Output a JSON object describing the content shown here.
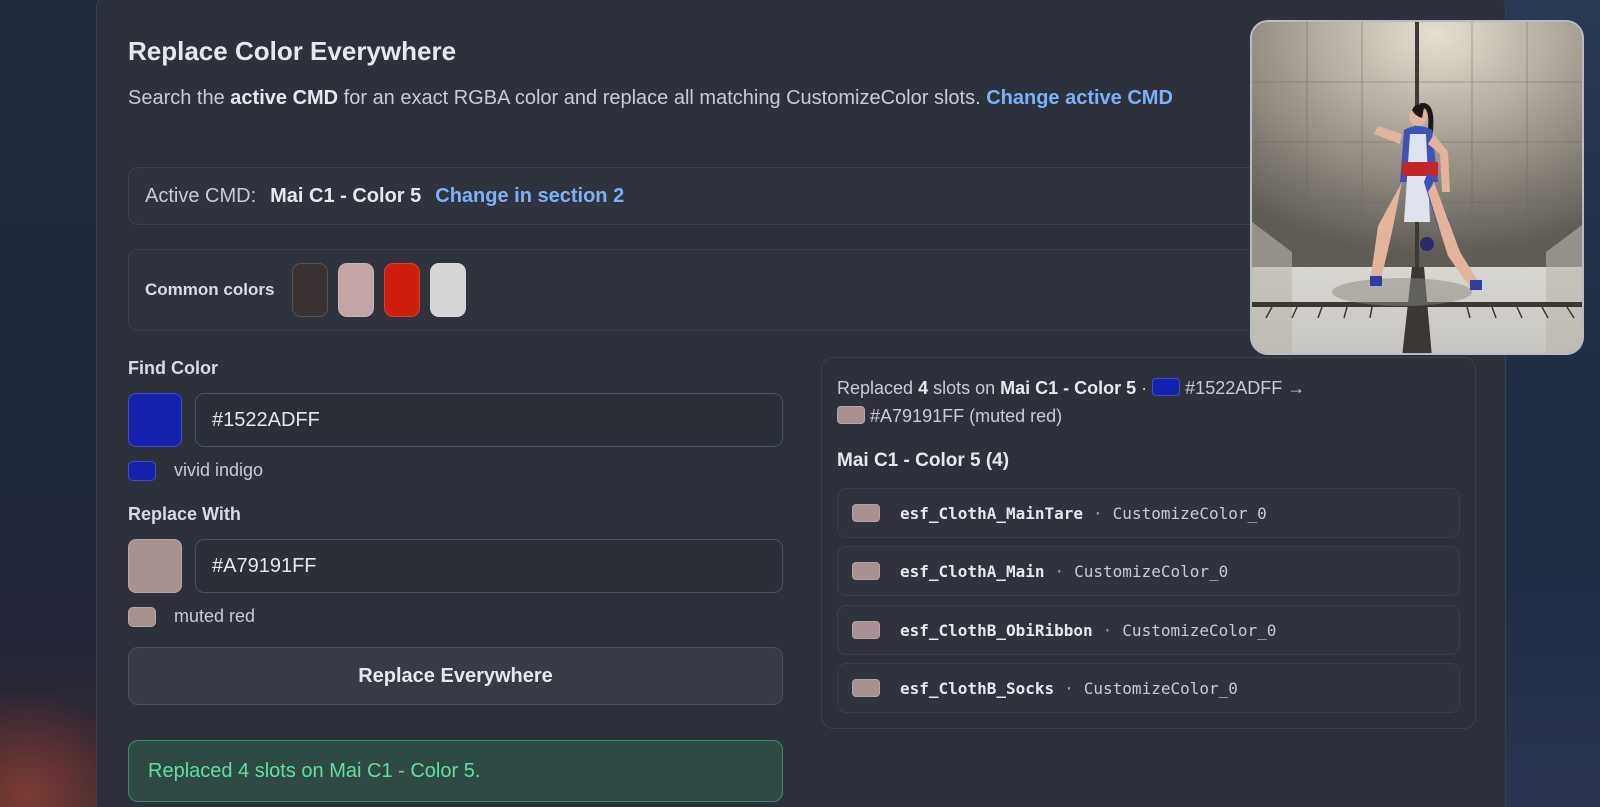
{
  "header": {
    "title": "Replace Color Everywhere",
    "desc_pre": "Search the ",
    "desc_bold": "active CMD",
    "desc_post": " for an exact RGBA color and replace all matching CustomizeColor slots. ",
    "desc_link": "Change active CMD"
  },
  "active": {
    "label": "Active CMD:",
    "cmd_name": "Mai C1 - Color 5",
    "link": "Change in section 2"
  },
  "common": {
    "label": "Common colors",
    "colors": [
      "#3a3232",
      "#c4a5a5",
      "#d01e0e",
      "#d4d4d4"
    ]
  },
  "find": {
    "label": "Find Color",
    "value": "#1522ADFF",
    "swatch": "#1522ad",
    "name": "vivid indigo"
  },
  "replace": {
    "label": "Replace With",
    "value": "#A79191FF",
    "swatch": "#a79191",
    "name": "muted red",
    "button": "Replace Everywhere"
  },
  "status": {
    "message": "Replaced 4 slots on Mai C1 - Color 5."
  },
  "results": {
    "summary_pre": "Replaced ",
    "summary_count": "4",
    "summary_mid": " slots on ",
    "summary_cmd": "Mai C1 - Color 5",
    "summary_dot": " · ",
    "from_hex": "#1522ADFF",
    "arrow": " →",
    "to_hex": "#A79191FF (muted red)",
    "group_title": "Mai C1 - Color 5 (4)",
    "separator": "·",
    "rows": [
      {
        "name": "esf_ClothA_MainTare",
        "slot": "CustomizeColor_0"
      },
      {
        "name": "esf_ClothA_Main",
        "slot": "CustomizeColor_0"
      },
      {
        "name": "esf_ClothB_ObiRibbon",
        "slot": "CustomizeColor_0"
      },
      {
        "name": "esf_ClothB_Socks",
        "slot": "CustomizeColor_0"
      }
    ]
  },
  "preview": {
    "icon": "character-preview-image"
  }
}
